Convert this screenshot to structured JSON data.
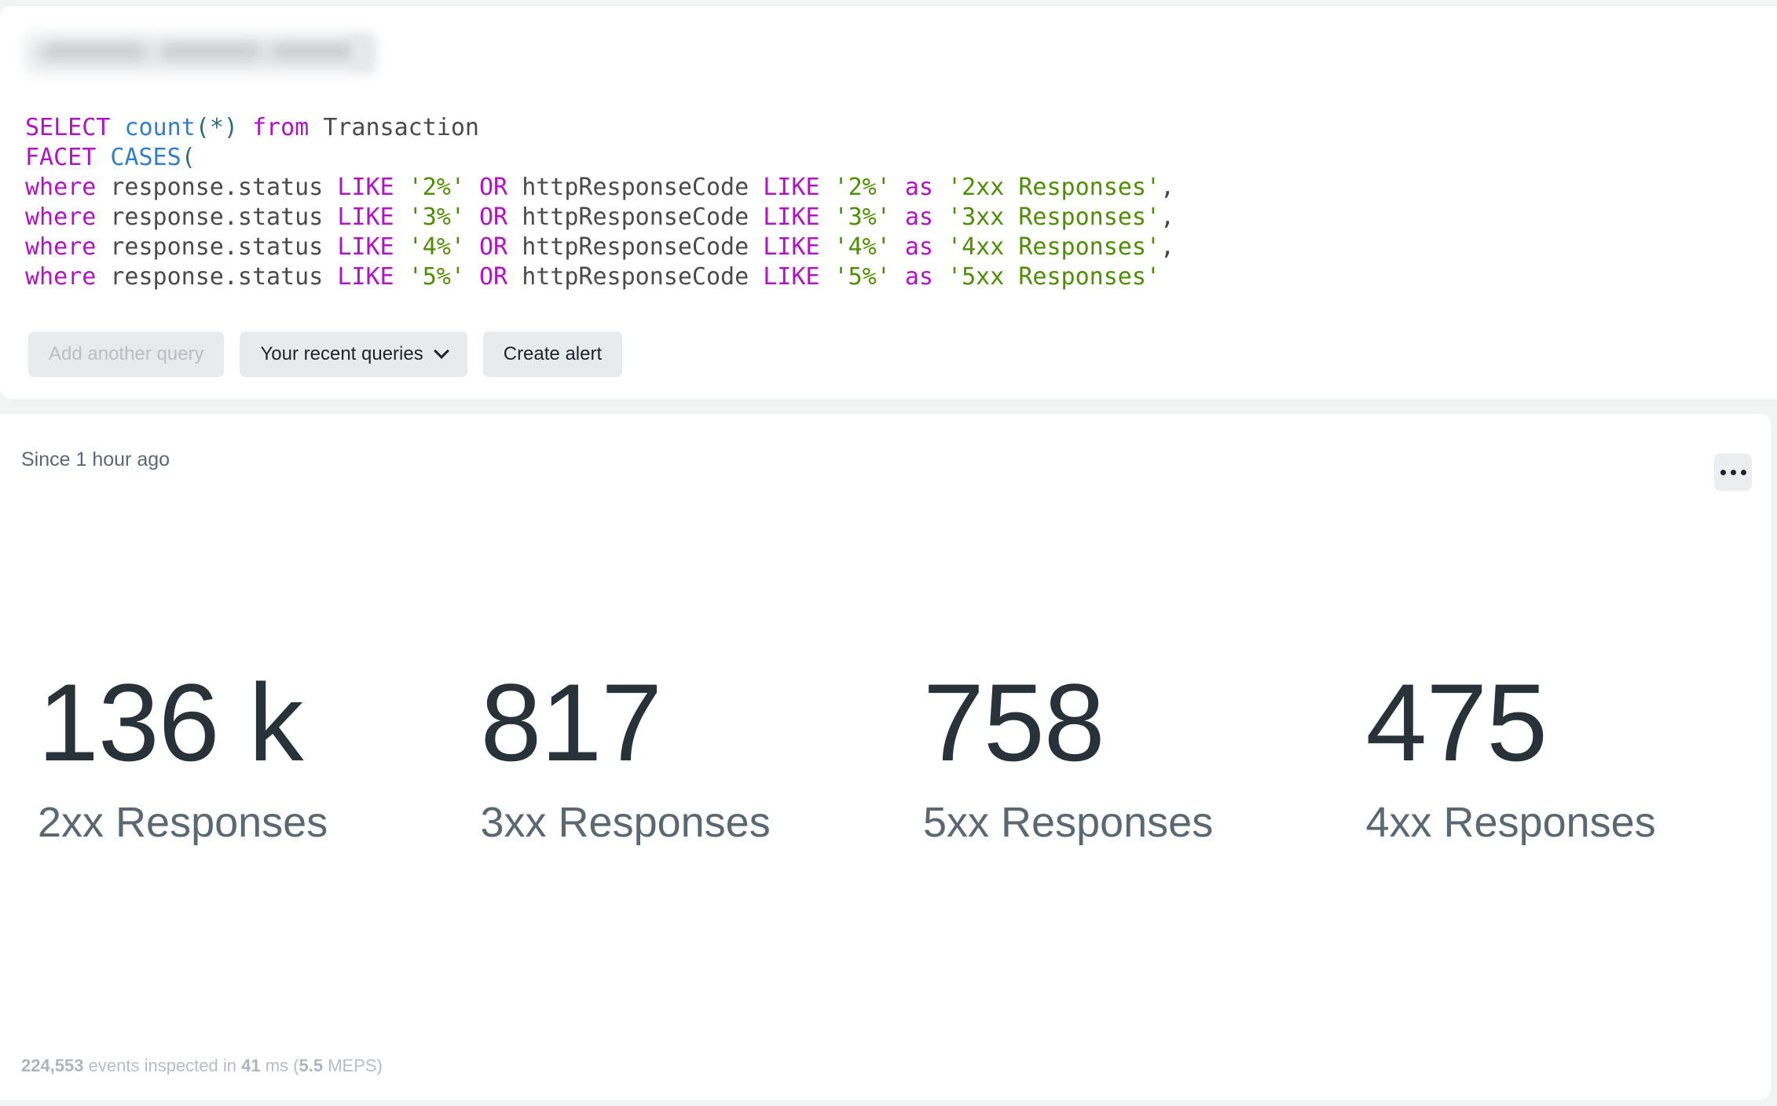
{
  "account_selector": {
    "redacted": true,
    "label": ""
  },
  "query": {
    "language": "NRQL",
    "lines": [
      [
        {
          "t": "SELECT",
          "c": "kw"
        },
        {
          "t": " ",
          "c": "id"
        },
        {
          "t": "count",
          "c": "fn"
        },
        {
          "t": "(",
          "c": "pn"
        },
        {
          "t": "*",
          "c": "pn"
        },
        {
          "t": ")",
          "c": "pn"
        },
        {
          "t": " ",
          "c": "id"
        },
        {
          "t": "from",
          "c": "kw"
        },
        {
          "t": " ",
          "c": "id"
        },
        {
          "t": "Transaction",
          "c": "id"
        }
      ],
      [
        {
          "t": "FACET",
          "c": "kw"
        },
        {
          "t": " ",
          "c": "id"
        },
        {
          "t": "CASES",
          "c": "fn"
        },
        {
          "t": "(",
          "c": "pn"
        }
      ],
      [
        {
          "t": "where",
          "c": "kw"
        },
        {
          "t": " ",
          "c": "id"
        },
        {
          "t": "response.status",
          "c": "id"
        },
        {
          "t": " ",
          "c": "id"
        },
        {
          "t": "LIKE",
          "c": "kw"
        },
        {
          "t": " ",
          "c": "id"
        },
        {
          "t": "'2%'",
          "c": "str"
        },
        {
          "t": " ",
          "c": "id"
        },
        {
          "t": "OR",
          "c": "kw"
        },
        {
          "t": " ",
          "c": "id"
        },
        {
          "t": "httpResponseCode",
          "c": "id"
        },
        {
          "t": " ",
          "c": "id"
        },
        {
          "t": "LIKE",
          "c": "kw"
        },
        {
          "t": " ",
          "c": "id"
        },
        {
          "t": "'2%'",
          "c": "str"
        },
        {
          "t": " ",
          "c": "id"
        },
        {
          "t": "as",
          "c": "kw"
        },
        {
          "t": " ",
          "c": "id"
        },
        {
          "t": "'2xx Responses'",
          "c": "str"
        },
        {
          "t": ",",
          "c": "cm"
        }
      ],
      [
        {
          "t": "where",
          "c": "kw"
        },
        {
          "t": " ",
          "c": "id"
        },
        {
          "t": "response.status",
          "c": "id"
        },
        {
          "t": " ",
          "c": "id"
        },
        {
          "t": "LIKE",
          "c": "kw"
        },
        {
          "t": " ",
          "c": "id"
        },
        {
          "t": "'3%'",
          "c": "str"
        },
        {
          "t": " ",
          "c": "id"
        },
        {
          "t": "OR",
          "c": "kw"
        },
        {
          "t": " ",
          "c": "id"
        },
        {
          "t": "httpResponseCode",
          "c": "id"
        },
        {
          "t": " ",
          "c": "id"
        },
        {
          "t": "LIKE",
          "c": "kw"
        },
        {
          "t": " ",
          "c": "id"
        },
        {
          "t": "'3%'",
          "c": "str"
        },
        {
          "t": " ",
          "c": "id"
        },
        {
          "t": "as",
          "c": "kw"
        },
        {
          "t": " ",
          "c": "id"
        },
        {
          "t": "'3xx Responses'",
          "c": "str"
        },
        {
          "t": ",",
          "c": "cm"
        }
      ],
      [
        {
          "t": "where",
          "c": "kw"
        },
        {
          "t": " ",
          "c": "id"
        },
        {
          "t": "response.status",
          "c": "id"
        },
        {
          "t": " ",
          "c": "id"
        },
        {
          "t": "LIKE",
          "c": "kw"
        },
        {
          "t": " ",
          "c": "id"
        },
        {
          "t": "'4%'",
          "c": "str"
        },
        {
          "t": " ",
          "c": "id"
        },
        {
          "t": "OR",
          "c": "kw"
        },
        {
          "t": " ",
          "c": "id"
        },
        {
          "t": "httpResponseCode",
          "c": "id"
        },
        {
          "t": " ",
          "c": "id"
        },
        {
          "t": "LIKE",
          "c": "kw"
        },
        {
          "t": " ",
          "c": "id"
        },
        {
          "t": "'4%'",
          "c": "str"
        },
        {
          "t": " ",
          "c": "id"
        },
        {
          "t": "as",
          "c": "kw"
        },
        {
          "t": " ",
          "c": "id"
        },
        {
          "t": "'4xx Responses'",
          "c": "str"
        },
        {
          "t": ",",
          "c": "cm"
        }
      ],
      [
        {
          "t": "where",
          "c": "kw"
        },
        {
          "t": " ",
          "c": "id"
        },
        {
          "t": "response.status",
          "c": "id"
        },
        {
          "t": " ",
          "c": "id"
        },
        {
          "t": "LIKE",
          "c": "kw"
        },
        {
          "t": " ",
          "c": "id"
        },
        {
          "t": "'5%'",
          "c": "str"
        },
        {
          "t": " ",
          "c": "id"
        },
        {
          "t": "OR",
          "c": "kw"
        },
        {
          "t": " ",
          "c": "id"
        },
        {
          "t": "httpResponseCode",
          "c": "id"
        },
        {
          "t": " ",
          "c": "id"
        },
        {
          "t": "LIKE",
          "c": "kw"
        },
        {
          "t": " ",
          "c": "id"
        },
        {
          "t": "'5%'",
          "c": "str"
        },
        {
          "t": " ",
          "c": "id"
        },
        {
          "t": "as",
          "c": "kw"
        },
        {
          "t": " ",
          "c": "id"
        },
        {
          "t": "'5xx Responses'",
          "c": "str"
        }
      ]
    ]
  },
  "toolbar": {
    "add_query_label": "Add another query",
    "add_query_disabled": true,
    "recent_queries_label": "Your recent queries",
    "create_alert_label": "Create alert"
  },
  "results": {
    "since_label": "Since 1 hour ago",
    "more_icon": "ellipsis-icon",
    "footer": {
      "events_count": "224,553",
      "events_text": " events inspected in ",
      "duration": "41",
      "duration_unit": " ms (",
      "rate": "5.5",
      "rate_unit": " MEPS)"
    }
  },
  "chart_data": {
    "type": "table",
    "title": "",
    "subtitle": "Since 1 hour ago",
    "visualization": "billboard",
    "categories": [
      "2xx Responses",
      "3xx Responses",
      "5xx Responses",
      "4xx Responses"
    ],
    "values": [
      "136 k",
      "817",
      "758",
      "475"
    ],
    "numeric_values": [
      136000,
      817,
      758,
      475
    ],
    "xlabel": "",
    "ylabel": "count(*)",
    "legend": "none",
    "grid": false
  },
  "colors": {
    "keyword": "#b114c4",
    "function": "#2f7fd0",
    "string": "#4d8f00",
    "punctuation": "#2f6e6e",
    "value_text": "#293238",
    "label_text": "#5b6871",
    "card_bg": "#ffffff",
    "page_bg": "#f2f4f4"
  }
}
